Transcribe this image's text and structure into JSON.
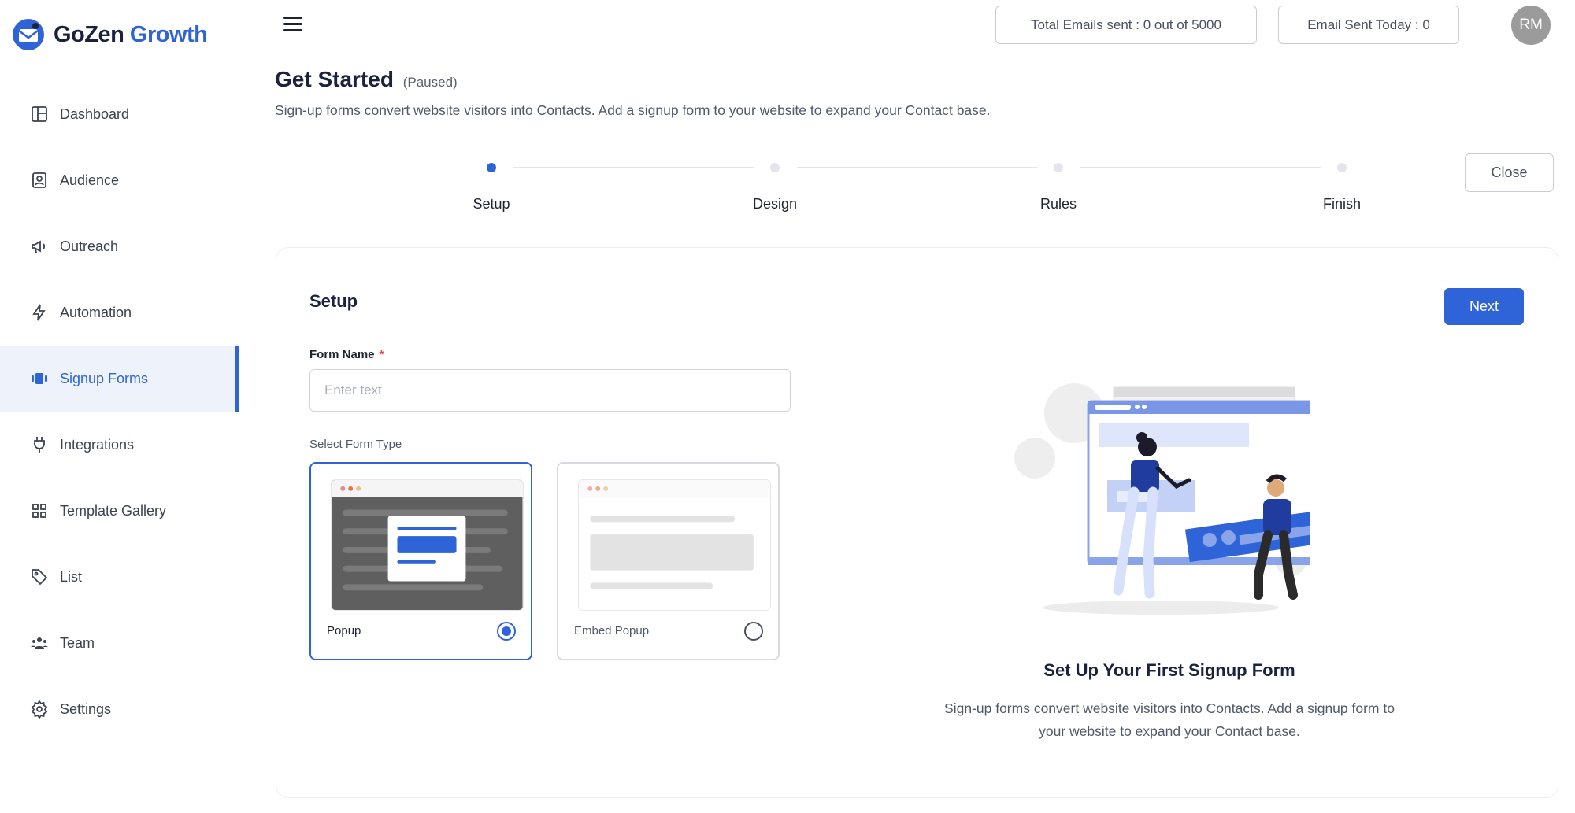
{
  "brand": {
    "name_part1": "GoZen",
    "name_part2": "Growth",
    "accent_color": "#2f64d8"
  },
  "sidebar": {
    "items": [
      {
        "label": "Dashboard",
        "icon": "dashboard-icon"
      },
      {
        "label": "Audience",
        "icon": "audience-icon"
      },
      {
        "label": "Outreach",
        "icon": "megaphone-icon"
      },
      {
        "label": "Automation",
        "icon": "lightning-icon"
      },
      {
        "label": "Signup Forms",
        "icon": "signup-forms-icon",
        "active": true
      },
      {
        "label": "Integrations",
        "icon": "plug-icon"
      },
      {
        "label": "Template Gallery",
        "icon": "grid-icon"
      },
      {
        "label": "List",
        "icon": "tag-icon"
      },
      {
        "label": "Team",
        "icon": "team-icon"
      },
      {
        "label": "Settings",
        "icon": "gear-icon"
      }
    ]
  },
  "header": {
    "total_emails": "Total Emails sent : 0 out of 5000",
    "emails_today": "Email Sent Today : 0",
    "avatar_initials": "RM"
  },
  "page": {
    "title": "Get Started",
    "status": "(Paused)",
    "subtitle": "Sign-up forms convert website visitors into Contacts. Add a signup form to your website to expand your Contact base.",
    "close_label": "Close"
  },
  "stepper": {
    "steps": [
      "Setup",
      "Design",
      "Rules",
      "Finish"
    ],
    "active_index": 0
  },
  "setup": {
    "title": "Setup",
    "next_label": "Next",
    "form_name_label": "Form Name",
    "required_mark": "*",
    "form_name_value": "",
    "form_name_placeholder": "Enter text",
    "form_type_label": "Select Form Type",
    "form_types": [
      {
        "label": "Popup",
        "selected": true
      },
      {
        "label": "Embed Popup",
        "selected": false
      }
    ]
  },
  "promo": {
    "title": "Set Up Your First Signup Form",
    "text": "Sign-up forms convert website visitors into Contacts. Add a signup form to your website to expand your Contact base."
  }
}
